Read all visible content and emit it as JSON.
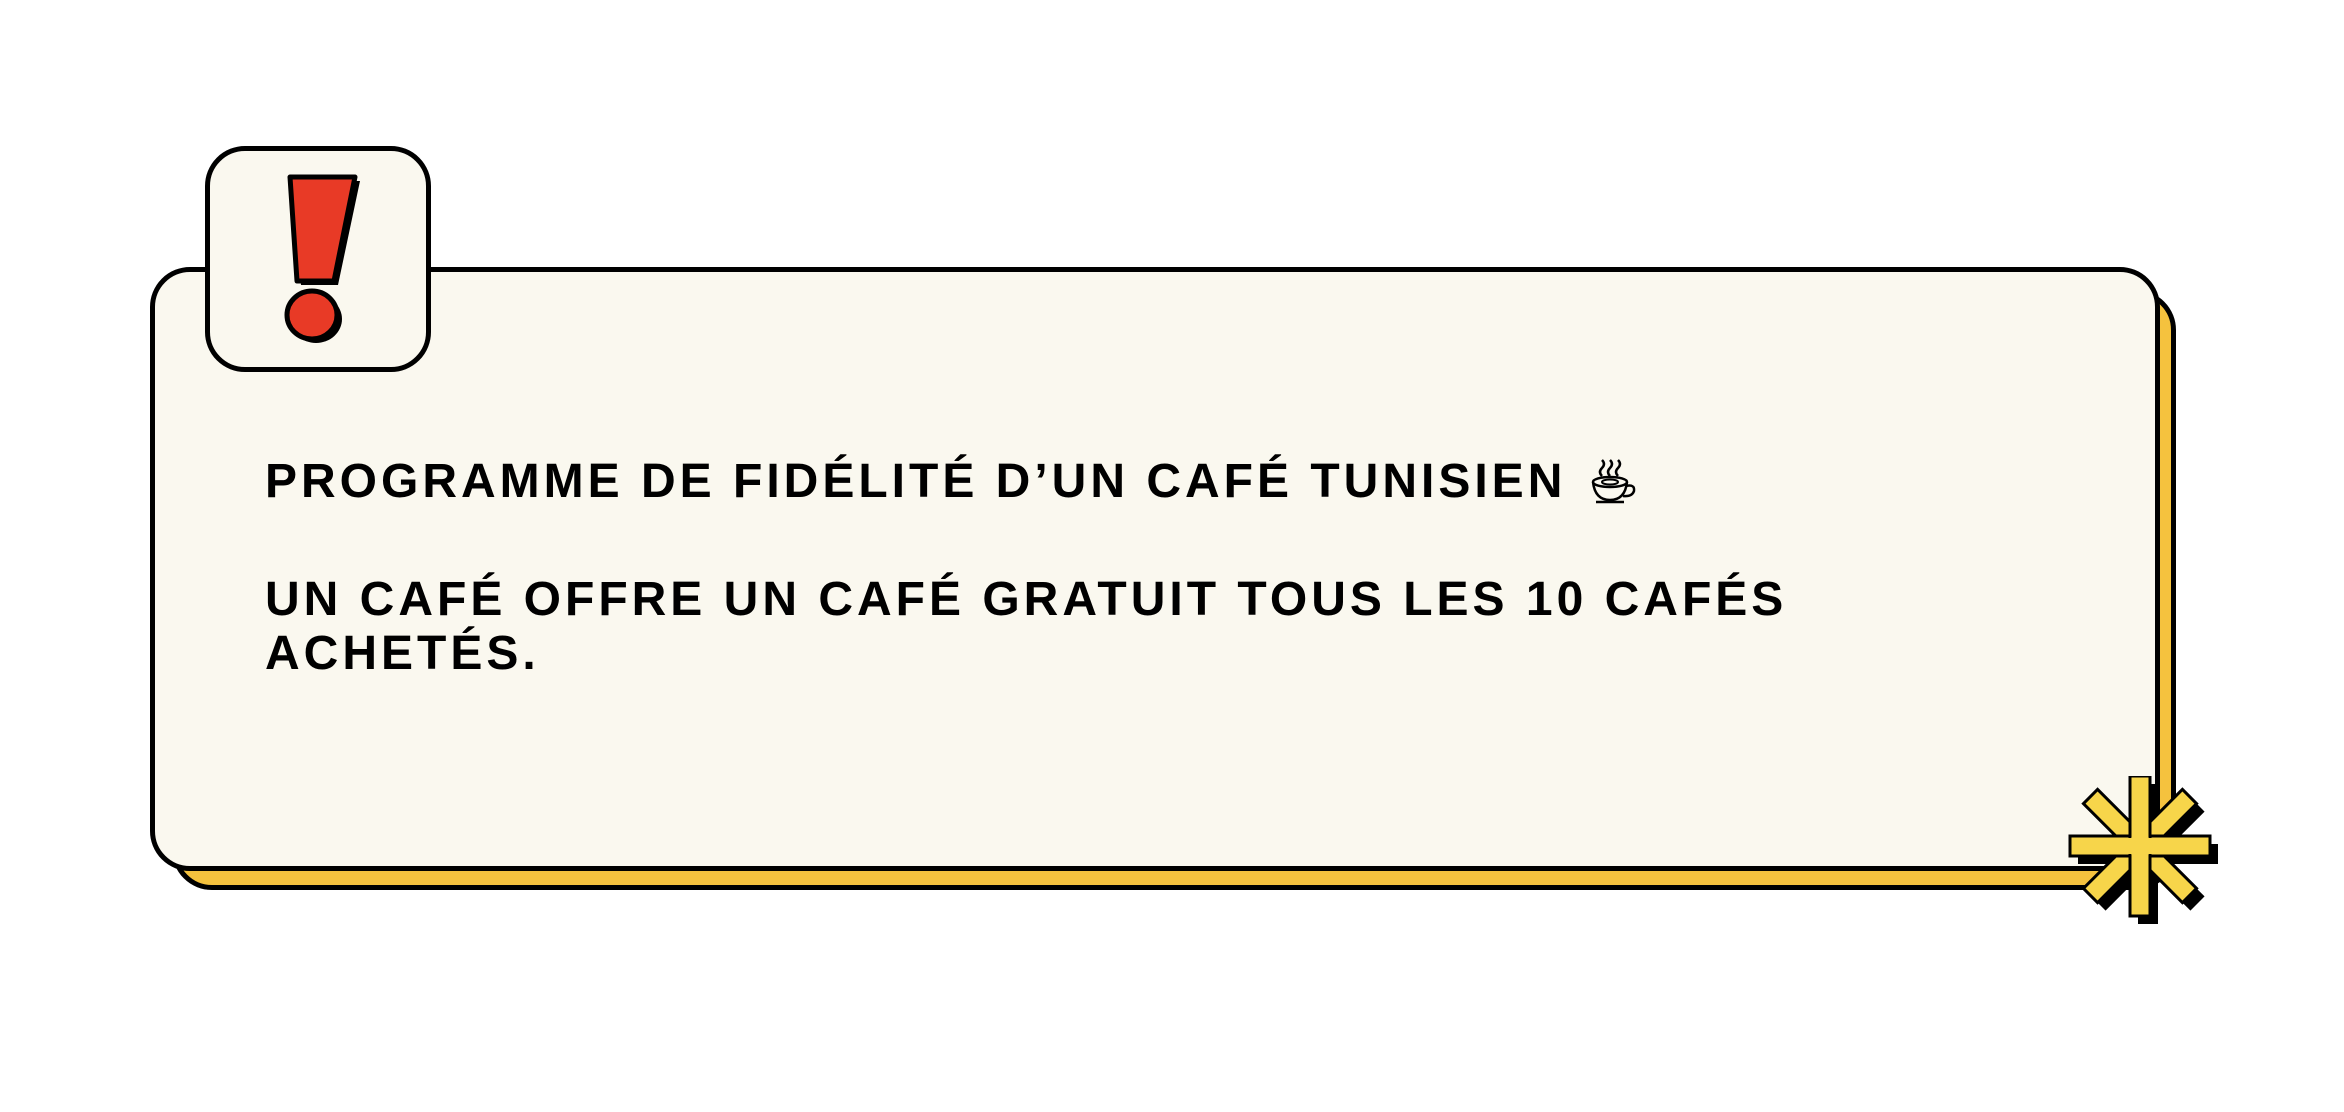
{
  "notice": {
    "title": "PROGRAMME DE FIDÉLITÉ D’UN CAFÉ TUNISIEN",
    "title_icon": "coffee-cup-icon",
    "body": "UN CAFÉ OFFRE UN CAFÉ GRATUIT TOUS LES 10 CAFÉS ACHETÉS.",
    "alert_icon": "exclamation-icon",
    "decor_icon": "asterisk-icon"
  },
  "colors": {
    "card_background": "#faf8ef",
    "card_shadow": "#f5c23e",
    "alert_red": "#e83a26",
    "asterisk_yellow": "#f7d54a",
    "outline": "#000000"
  }
}
